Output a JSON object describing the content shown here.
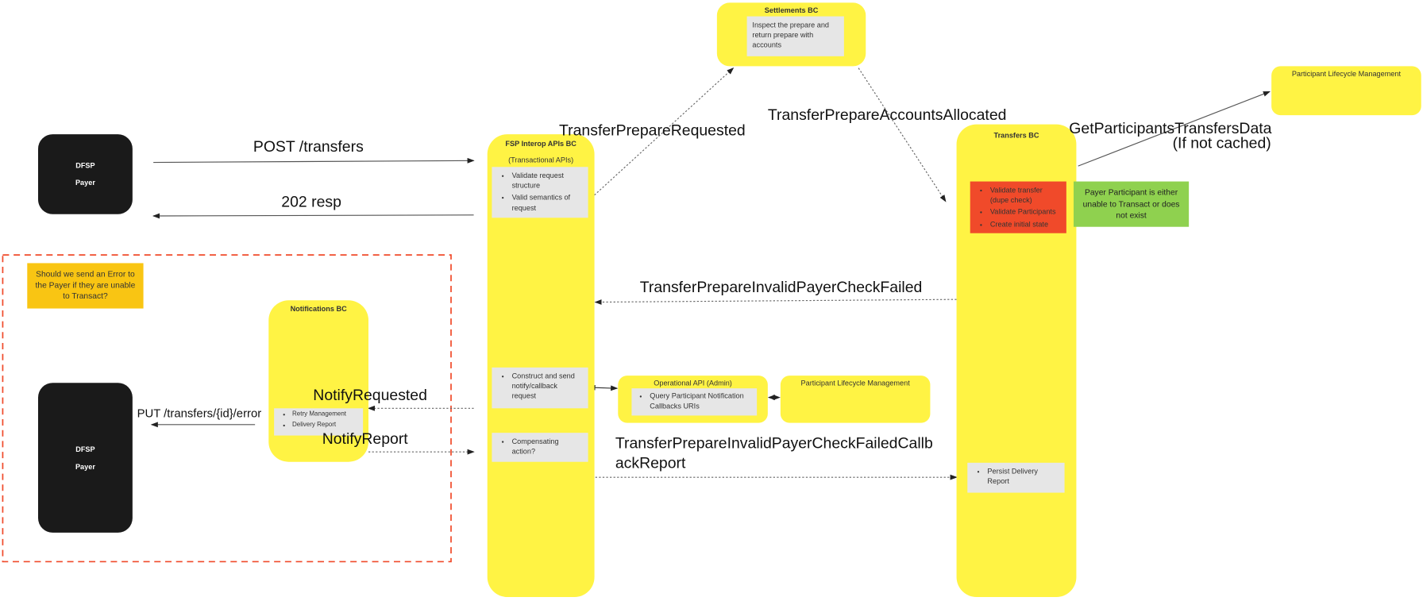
{
  "colors": {
    "bc_yellow": "#fff344",
    "dfsp_black": "#1a1a1a",
    "note_orange": "#f9c513",
    "error_red": "#f04a2a",
    "info_green": "#8fd14f",
    "boundary_red": "#f04a2a",
    "detail_gray": "#e6e6e6"
  },
  "dfsp_top": {
    "line1": "DFSP",
    "line2": "Payer"
  },
  "dfsp_bottom": {
    "line1": "DFSP",
    "line2": "Payer"
  },
  "note": "Should we send an Error to the Payer if they are unable to Transact?",
  "notifications": {
    "title": "Notifications BC",
    "items": [
      "Retry Management",
      "Delivery Report"
    ]
  },
  "fsp": {
    "title": "FSP Interop APIs BC",
    "subtitle": "(Transactional APIs)",
    "box1": [
      "Validate request structure",
      "Valid semantics of request"
    ],
    "box2": [
      "Construct and send notify/callback request"
    ],
    "box3": [
      "Compensating action?"
    ]
  },
  "settlements": {
    "title": "Settlements BC",
    "text": "Inspect the prepare and return prepare with accounts"
  },
  "transfers": {
    "title": "Transfers BC",
    "red_items": [
      "Validate transfer (dupe check)",
      "Validate Participants",
      "Create initial state"
    ],
    "persist_items": [
      "Persist Delivery Report"
    ]
  },
  "green_note": "Payer Participant is either unable to Transact or does not exist",
  "plm_top": {
    "title": "Participant Lifecycle Management"
  },
  "plm_mid": {
    "title": "Participant Lifecycle Management"
  },
  "opapi": {
    "title": "Operational API (Admin)",
    "items": [
      "Query Participant Notification Callbacks URIs"
    ]
  },
  "labels": {
    "post": "POST /transfers",
    "resp": "202 resp",
    "prep_req": "TransferPrepareRequested",
    "accts": "TransferPrepareAccountsAllocated",
    "getp": "GetParticipantsTransfersData",
    "getp2": "(If not cached)",
    "invalid": "TransferPrepareInvalidPayerCheckFailed",
    "notify_req": "NotifyRequested",
    "put_err": "PUT /transfers/{id}/error",
    "notify_rep": "NotifyReport",
    "cb1": "TransferPrepareInvalidPayerCheckFailedCallb",
    "cb2": "ackReport"
  }
}
